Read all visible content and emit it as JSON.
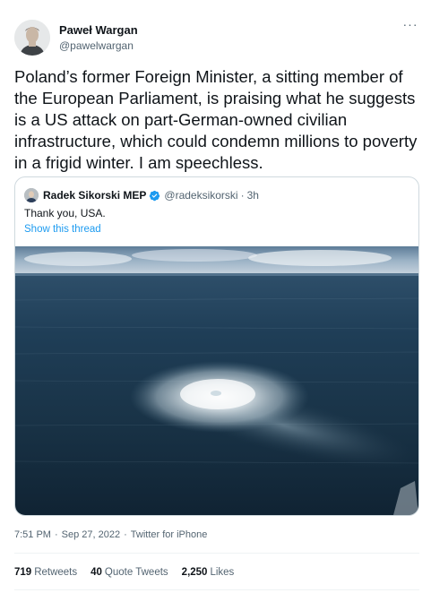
{
  "author": {
    "display_name": "Paweł Wargan",
    "handle": "@pawelwargan",
    "avatar_icon": "avatar-icon"
  },
  "more_menu": "···",
  "tweet_text": "Poland’s former Foreign Minister, a sitting member of the European Parliament, is praising what he suggests is a US attack on part-German-owned civilian infrastructure, which could condemn millions to poverty in a frigid winter. I am speechless.",
  "quoted_tweet": {
    "display_name": "Radek Sikorski MEP",
    "handle": "@radeksikorski",
    "separator": "·",
    "time": "3h",
    "text": "Thank you, USA.",
    "show_thread": "Show this thread",
    "verified_color": "#1d9bf0"
  },
  "meta": {
    "time": "7:51 PM",
    "date": "Sep 27, 2022",
    "source": "Twitter for iPhone",
    "separator": "·"
  },
  "stats": {
    "retweets_count": "719",
    "retweets_label": "Retweets",
    "quotes_count": "40",
    "quotes_label": "Quote Tweets",
    "likes_count": "2,250",
    "likes_label": "Likes"
  },
  "colors": {
    "link": "#1d9bf0",
    "secondary_text": "#536471",
    "primary_text": "#0f1419",
    "border": "#cfd9de"
  }
}
